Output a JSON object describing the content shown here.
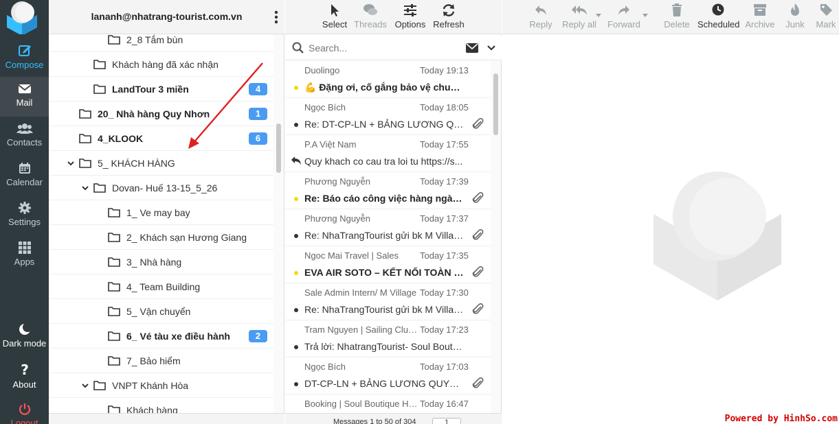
{
  "nav": {
    "compose": "Compose",
    "mail": "Mail",
    "contacts": "Contacts",
    "calendar": "Calendar",
    "settings": "Settings",
    "apps": "Apps",
    "dark_mode": "Dark mode",
    "about": "About",
    "logout": "Logout"
  },
  "account": {
    "email": "lananh@nhatrang-tourist.com.vn"
  },
  "folders": [
    {
      "label": "2_8 Tắm bùn",
      "depth": 3,
      "bold": false,
      "badge": ""
    },
    {
      "label": "Khách hàng đã xác nhận",
      "depth": 2,
      "bold": false,
      "badge": ""
    },
    {
      "label": "LandTour 3 miền",
      "depth": 2,
      "bold": true,
      "badge": "4"
    },
    {
      "label": "20_ Nhà hàng Quy Nhơn",
      "depth": 1,
      "bold": true,
      "badge": "1"
    },
    {
      "label": "4_KLOOK",
      "depth": 1,
      "bold": true,
      "badge": "6"
    },
    {
      "label": "5_ KHÁCH HÀNG",
      "depth": 1,
      "bold": false,
      "badge": "",
      "expanded": true
    },
    {
      "label": "Dovan- Huế 13-15_5_26",
      "depth": 2,
      "bold": false,
      "badge": "",
      "expanded": true
    },
    {
      "label": "1_ Ve may bay",
      "depth": 3,
      "bold": false,
      "badge": ""
    },
    {
      "label": "2_ Khách sạn Hương Giang",
      "depth": 3,
      "bold": false,
      "badge": ""
    },
    {
      "label": "3_ Nhà hàng",
      "depth": 3,
      "bold": false,
      "badge": ""
    },
    {
      "label": "4_ Team Building",
      "depth": 3,
      "bold": false,
      "badge": ""
    },
    {
      "label": "5_ Vận chuyển",
      "depth": 3,
      "bold": false,
      "badge": ""
    },
    {
      "label": "6_ Vé tàu xe điều hành",
      "depth": 3,
      "bold": true,
      "badge": "2"
    },
    {
      "label": "7_ Bảo hiểm",
      "depth": 3,
      "bold": false,
      "badge": ""
    },
    {
      "label": "VNPT Khánh Hòa",
      "depth": 2,
      "bold": false,
      "badge": "",
      "expanded": true
    },
    {
      "label": "Khách hàng",
      "depth": 3,
      "bold": false,
      "badge": ""
    }
  ],
  "list_toolbar": {
    "select": "Select",
    "threads": "Threads",
    "options": "Options",
    "refresh": "Refresh"
  },
  "search": {
    "placeholder": "Search..."
  },
  "messages": [
    {
      "from": "Duolingo",
      "date": "Today 19:13",
      "subject": "💪 Đặng ơi, cố gắng bảo vệ chuỗi 1...",
      "unread": true,
      "flag": true,
      "attachment": false,
      "replied": false
    },
    {
      "from": "Ngọc Bích",
      "date": "Today 18:05",
      "subject": "Re: DT-CP-LN + BẢNG LƯƠNG QUYẾT...",
      "unread": false,
      "flag": false,
      "attachment": true,
      "replied": false
    },
    {
      "from": "P.A Việt Nam",
      "date": "Today 17:55",
      "subject": "Quy khach co cau tra loi tu https://s...",
      "unread": false,
      "flag": false,
      "attachment": false,
      "replied": true
    },
    {
      "from": "Phương Nguyễn",
      "date": "Today 17:39",
      "subject": "Re: Báo cáo công việc hàng ngày 1...",
      "unread": true,
      "flag": true,
      "attachment": true,
      "replied": false
    },
    {
      "from": "Phương Nguyễn",
      "date": "Today 17:37",
      "subject": "Re: NhaTrangTourist gửi bk M Villag...",
      "unread": false,
      "flag": false,
      "attachment": true,
      "replied": false
    },
    {
      "from": "Ngoc Mai Travel | Sales",
      "date": "Today 17:35",
      "subject": "EVA AIR SOTO – KẾT NỐI TOÀN CẦ...",
      "unread": true,
      "flag": true,
      "attachment": true,
      "replied": false
    },
    {
      "from": "Sale Admin Intern/ M Village",
      "date": "Today 17:30",
      "subject": "Re: NhaTrangTourist gửi bk M Villag...",
      "unread": false,
      "flag": false,
      "attachment": true,
      "replied": false
    },
    {
      "from": "Tram Nguyen | Sailing Club...",
      "date": "Today 17:23",
      "subject": "Trả lời: NhatrangTourist- Soul Boutiq...",
      "unread": false,
      "flag": false,
      "attachment": false,
      "replied": false
    },
    {
      "from": "Ngọc Bích",
      "date": "Today 17:03",
      "subject": "DT-CP-LN + BẢNG LƯƠNG QUYẾT T...",
      "unread": false,
      "flag": false,
      "attachment": true,
      "replied": false
    },
    {
      "from": "Booking | Soul Boutique Ho...",
      "date": "Today 16:47",
      "subject": "",
      "unread": false,
      "flag": false,
      "attachment": false,
      "replied": false
    }
  ],
  "pagination": {
    "info": "Messages 1 to 50 of 304",
    "page": "1"
  },
  "content_toolbar": {
    "reply": "Reply",
    "reply_all": "Reply all",
    "forward": "Forward",
    "delete": "Delete",
    "scheduled": "Scheduled",
    "archive": "Archive",
    "junk": "Junk",
    "mark": "Mark"
  },
  "watermark": "Powered by HinhSo.com",
  "colors": {
    "accent": "#37beff",
    "badge": "#4a9cf2",
    "flag": "#f5d90a",
    "arrow": "#e02020"
  }
}
